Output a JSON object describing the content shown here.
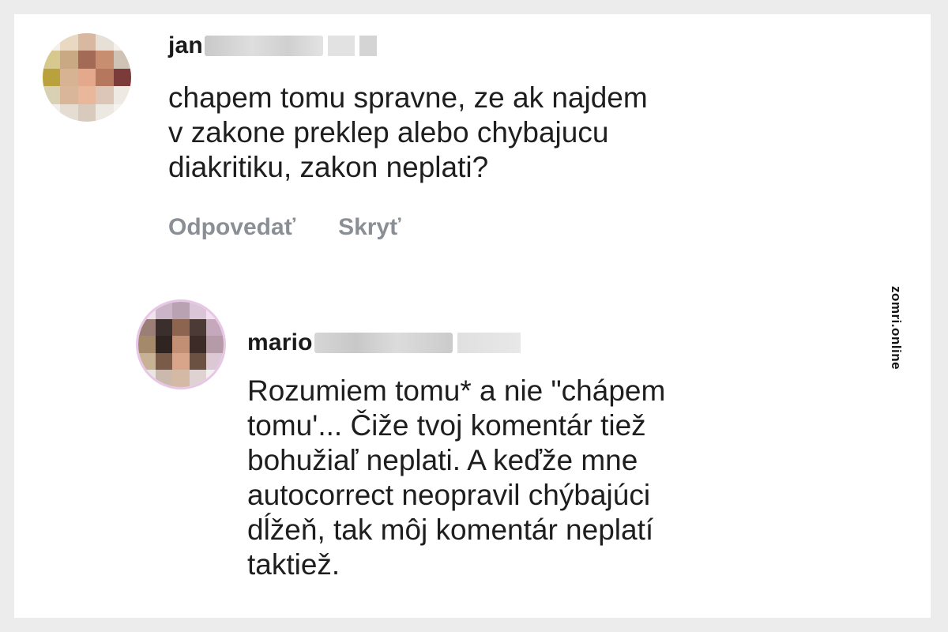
{
  "comments": [
    {
      "username": "jan",
      "text": "chapem tomu spravne, ze ak najdem\nv zakone preklep alebo chybajucu\ndiakritiku, zakon neplati?",
      "actions": {
        "reply": "Odpovedať",
        "hide": "Skryť"
      }
    },
    {
      "username": "mario",
      "text": "Rozumiem tomu* a nie \"chápem\ntomu'... Čiže tvoj komentár tiež\nbohužiaľ neplati. A keďže mne\nautocorrect neopravil chýbajúci\ndĺžeň, tak môj komentár neplatí\ntaktiež."
    }
  ],
  "watermark": "zomri.online",
  "colors": {
    "background": "#ececec",
    "card": "#ffffff",
    "text": "#1e1e1e",
    "action_text": "#8a8f96"
  }
}
